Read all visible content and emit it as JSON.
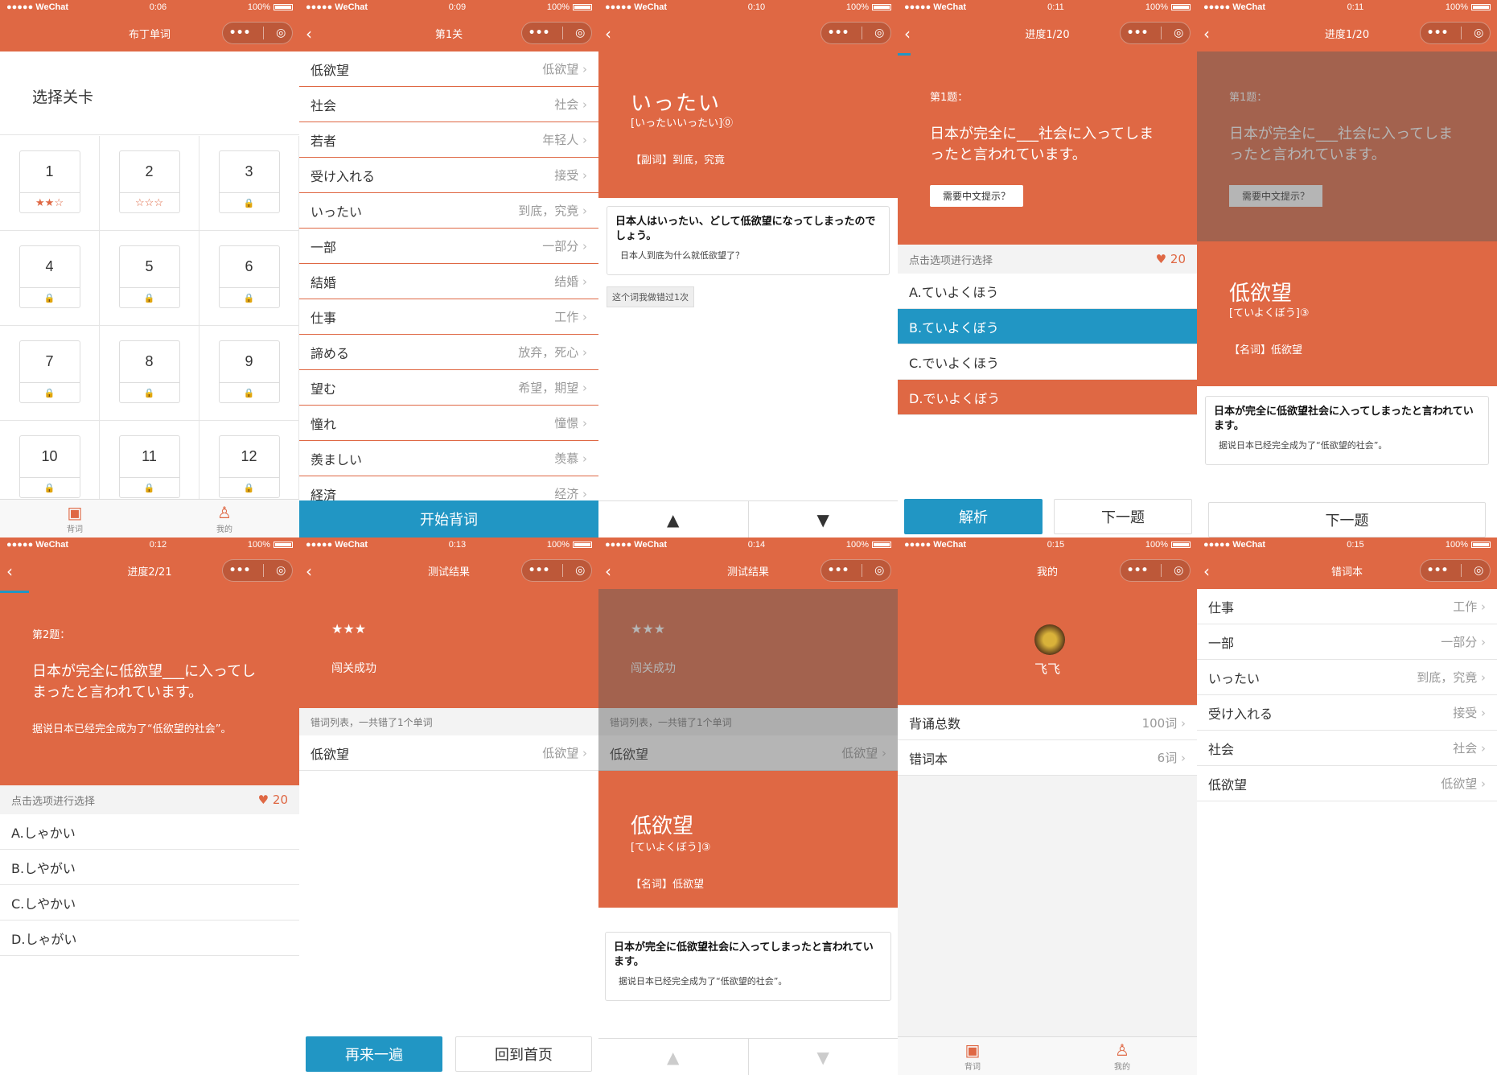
{
  "status": {
    "carrier": "●●●●● WeChat",
    "battery": "100%",
    "times": [
      "0:06",
      "0:09",
      "0:10",
      "0:11",
      "0:11",
      "0:12",
      "0:13",
      "0:14",
      "0:15",
      "0:15"
    ]
  },
  "p1": {
    "title": "布丁单词",
    "heading": "选择关卡",
    "levels": [
      "1",
      "2",
      "3",
      "4",
      "5",
      "6",
      "7",
      "8",
      "9",
      "10",
      "11",
      "12"
    ],
    "stars": [
      "★★☆",
      "☆☆☆"
    ],
    "tab1": "背词",
    "tab2": "我的"
  },
  "p2": {
    "title": "第1关",
    "words": [
      [
        "低欲望",
        "低欲望"
      ],
      [
        "社会",
        "社会"
      ],
      [
        "若者",
        "年轻人"
      ],
      [
        "受け入れる",
        "接受"
      ],
      [
        "いったい",
        "到底，究竟"
      ],
      [
        "一部",
        "一部分"
      ],
      [
        "結婚",
        "结婚"
      ],
      [
        "仕事",
        "工作"
      ],
      [
        "諦める",
        "放弃，死心"
      ],
      [
        "望む",
        "希望，期望"
      ],
      [
        "憧れ",
        "憧憬"
      ],
      [
        "羨ましい",
        "羡慕"
      ],
      [
        "経済",
        "经济"
      ]
    ],
    "start": "开始背词"
  },
  "p3": {
    "word": "いったい",
    "reading": "[いったいいったい]⓪",
    "meaning": "【副词】到底，究竟",
    "ex_jp": "日本人はいったい、どして低欲望になってしまったのでしょう。",
    "ex_cn": "日本人到底为什么就低欲望了？",
    "wrong": "这个词我做错过1次"
  },
  "p4": {
    "title": "进度1/20",
    "qnum": "第1题：",
    "question": "日本が完全に___社会に入ってしまったと言われています。",
    "hint": "需要中文提示？",
    "prompt": "点击选项进行选择",
    "hearts": "20",
    "options": [
      "A.ていよくほう",
      "B.ていよくぼう",
      "C.でいよくほう",
      "D.でいよくぼう"
    ],
    "analyze": "解析",
    "next": "下一题"
  },
  "p5": {
    "title": "进度1/20",
    "qnum": "第1题：",
    "question": "日本が完全に___社会に入ってしまったと言われています。",
    "hint": "需要中文提示？",
    "word": "低欲望",
    "reading": "[ていよくぼう]③",
    "meaning": "【名词】低欲望",
    "ex_jp": "日本が完全に低欲望社会に入ってしまったと言われています。",
    "ex_cn": "据说日本已经完全成为了“低欲望的社会”。",
    "next": "下一题"
  },
  "p6": {
    "title": "进度2/21",
    "qnum": "第2题：",
    "question": "日本が完全に低欲望___に入ってしまったと言われています。",
    "hint_cn": "据说日本已经完全成为了“低欲望的社会”。",
    "prompt": "点击选项进行选择",
    "hearts": "20",
    "options": [
      "A.しゃかい",
      "B.しやがい",
      "C.しやかい",
      "D.しゃがい"
    ]
  },
  "p7": {
    "title": "测试结果",
    "stars": "★★★",
    "result": "闯关成功",
    "list_title": "错词列表，一共错了1个单词",
    "word": "低欲望",
    "meaning": "低欲望",
    "again": "再来一遍",
    "home": "回到首页"
  },
  "p8": {
    "title": "测试结果",
    "stars": "★★★",
    "result": "闯关成功",
    "list_title": "错词列表，一共错了1个单词",
    "word": "低欲望",
    "meaning": "低欲望",
    "reading": "[ていよくぼう]③",
    "def": "【名词】低欲望",
    "ex_jp": "日本が完全に低欲望社会に入ってしまったと言われています。",
    "ex_cn": "据说日本已经完全成为了“低欲望的社会”。"
  },
  "p9": {
    "title": "我的",
    "name": "飞飞",
    "rows": [
      [
        "背诵总数",
        "100词"
      ],
      [
        "错词本",
        "6词"
      ]
    ],
    "tab1": "背词",
    "tab2": "我的"
  },
  "p10": {
    "title": "错词本",
    "words": [
      [
        "仕事",
        "工作"
      ],
      [
        "一部",
        "一部分"
      ],
      [
        "いったい",
        "到底，究竟"
      ],
      [
        "受け入れる",
        "接受"
      ],
      [
        "社会",
        "社会"
      ],
      [
        "低欲望",
        "低欲望"
      ]
    ]
  },
  "colors": {
    "orange": "#df6844",
    "blue": "#2196c4"
  }
}
